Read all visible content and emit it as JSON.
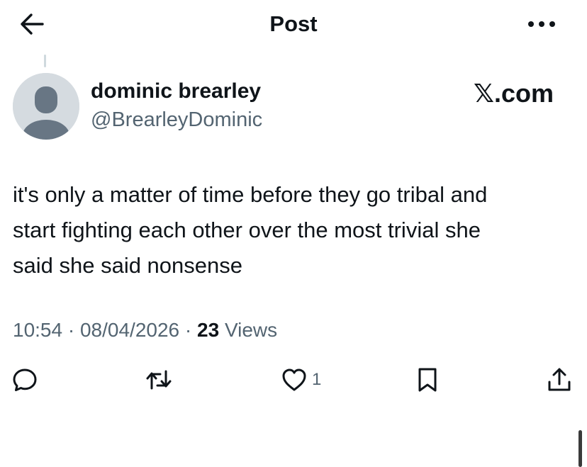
{
  "header": {
    "title": "Post",
    "back_icon": "arrow-left-icon",
    "more_icon": "ellipsis-icon"
  },
  "author": {
    "display_name": "dominic brearley",
    "handle": "@BrearleyDominic",
    "avatar_icon": "default-avatar-icon"
  },
  "watermark": "𝕏.com",
  "tweet": {
    "text": "it's only a matter of time before they go tribal and\nstart fighting each other over the most trivial she\nsaid she said nonsense"
  },
  "meta": {
    "time": "10:54",
    "separator": " · ",
    "date": "08/04/2026",
    "views_count": "23",
    "views_label": "Views"
  },
  "actions": {
    "reply_icon": "reply-icon",
    "retweet_icon": "retweet-icon",
    "like_icon": "heart-icon",
    "like_count": "1",
    "bookmark_icon": "bookmark-icon",
    "share_icon": "share-icon"
  },
  "colors": {
    "text": "#0f1419",
    "secondary": "#536471",
    "avatar_bg": "#d5dbe0",
    "avatar_fg": "#687684"
  }
}
